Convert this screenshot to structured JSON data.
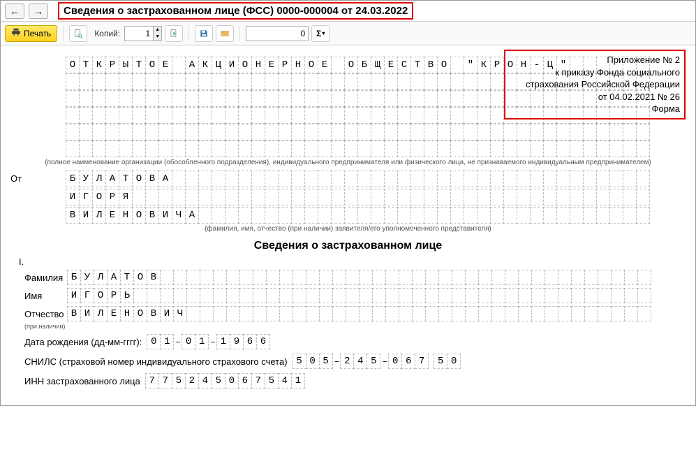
{
  "title": "Сведения о застрахованном лице (ФСС) 0000-000004 от 24.03.2022",
  "toolbar": {
    "print_label": "Печать",
    "copies_label": "Копий:",
    "copies_value": "1",
    "num_value": "0",
    "sigma": "Σ"
  },
  "appendix": {
    "l1": "Приложение № 2",
    "l2": "к приказу Фонда социального",
    "l3": "страхования Российской Федерации",
    "l4": "от 04.02.2021 № 26",
    "l5": "Форма"
  },
  "org_name_rows": [
    "ОТКРЫТОЕ АКЦИОНЕРНОЕ ОБЩЕСТВО \"КРОН-Ц\"",
    "",
    "",
    "",
    "",
    ""
  ],
  "org_cols": 44,
  "org_footnote": "(полное наименование организации (обособленного подразделения), индивидуального предпринимателя или физического лица, не признаваемого индивидуальным предпринимателем)",
  "from_label": "От",
  "from_rows": [
    "БУЛАТОВА",
    "ИГОРЯ",
    "ВИЛЕНОВИЧА"
  ],
  "from_cols": 44,
  "from_footnote": "(фамилия, имя, отчество (при наличии) заявителя/его уполномоченного представителя)",
  "section_title": "Сведения о застрахованном лице",
  "roman": "I.",
  "person": {
    "last_label": "Фамилия",
    "first_label": "Имя",
    "patr_label": "Отчество",
    "patr_note": "(при наличии)",
    "last": "БУЛАТОВ",
    "first": "ИГОРЬ",
    "patr": "ВИЛЕНОВИЧ",
    "cols": 44
  },
  "dob": {
    "label": "Дата рождения (дд-мм-гггг):",
    "dd": "01",
    "mm": "01",
    "yyyy": "1966"
  },
  "snils": {
    "label": "СНИЛС (страховой номер индивидуального страхового счета)",
    "g1": "505",
    "g2": "245",
    "g3": "067",
    "g4": "50"
  },
  "inn": {
    "label": "ИНН застрахованного лица",
    "value": "775245067541"
  }
}
